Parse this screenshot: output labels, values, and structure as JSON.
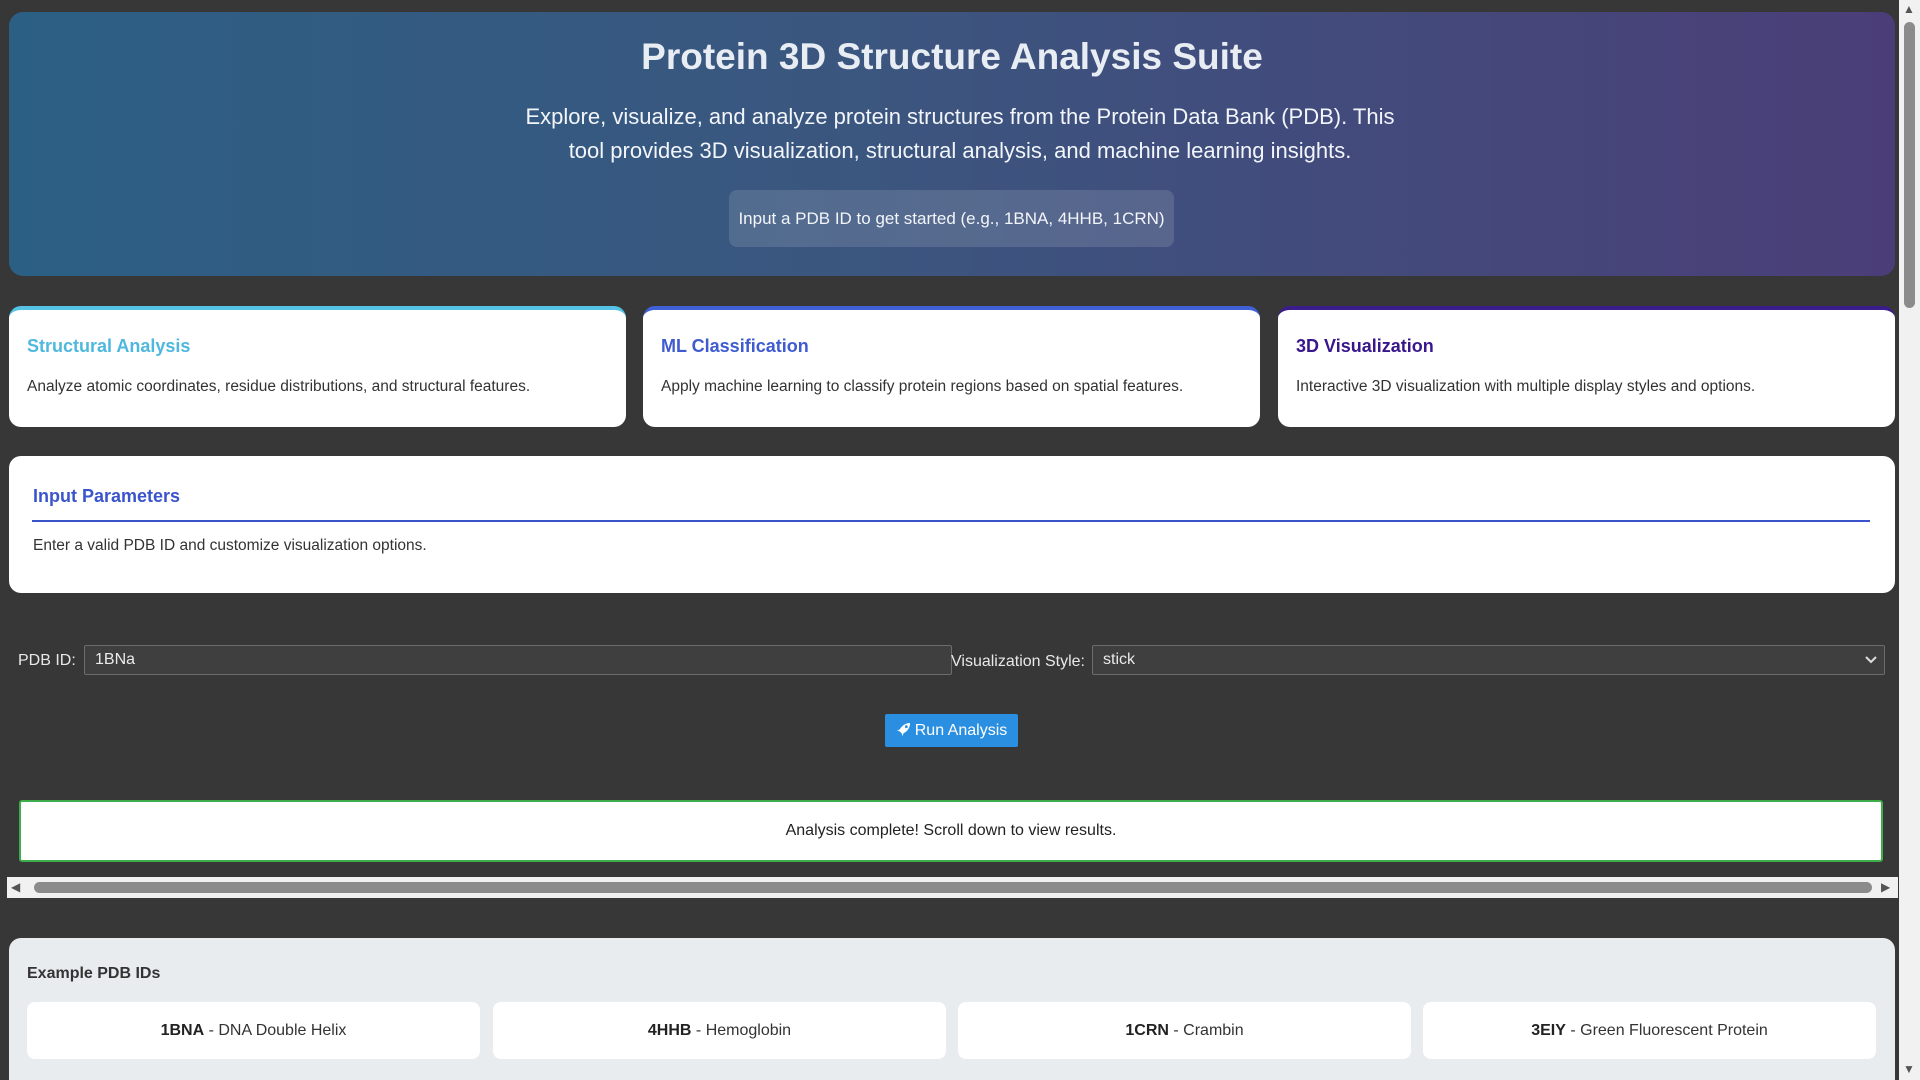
{
  "header": {
    "title": "Protein 3D Structure Analysis Suite",
    "description": "Explore, visualize, and analyze protein structures from the Protein Data Bank (PDB). This tool provides 3D visualization, structural analysis, and machine learning insights.",
    "hint": "Input a PDB ID to get started (e.g., 1BNA, 4HHB, 1CRN)"
  },
  "cards": [
    {
      "title": "Structural Analysis",
      "text": "Analyze atomic coordinates, residue distributions, and structural features."
    },
    {
      "title": "ML Classification",
      "text": "Apply machine learning to classify protein regions based on spatial features."
    },
    {
      "title": "3D Visualization",
      "text": "Interactive 3D visualization with multiple display styles and options."
    }
  ],
  "params": {
    "title": "Input Parameters",
    "text": "Enter a valid PDB ID and customize visualization options."
  },
  "form": {
    "pdb_label": "PDB ID:",
    "pdb_value": "1BNa",
    "style_label": "Visualization Style:",
    "style_value": "stick",
    "run_label": "Run Analysis"
  },
  "status": "Analysis complete! Scroll down to view results.",
  "examples": {
    "title": "Example PDB IDs",
    "items": [
      {
        "id": "1BNA",
        "name": " - DNA Double Helix"
      },
      {
        "id": "4HHB",
        "name": " - Hemoglobin"
      },
      {
        "id": "1CRN",
        "name": " - Crambin"
      },
      {
        "id": "3EIY",
        "name": " - Green Fluorescent Protein"
      }
    ]
  },
  "icons": {
    "run": "rocket-icon",
    "select": "chevron-down-icon"
  },
  "colors": {
    "accent": "#3a55cc",
    "run_button": "#2a8fe0",
    "success_border": "#3fae4a"
  }
}
